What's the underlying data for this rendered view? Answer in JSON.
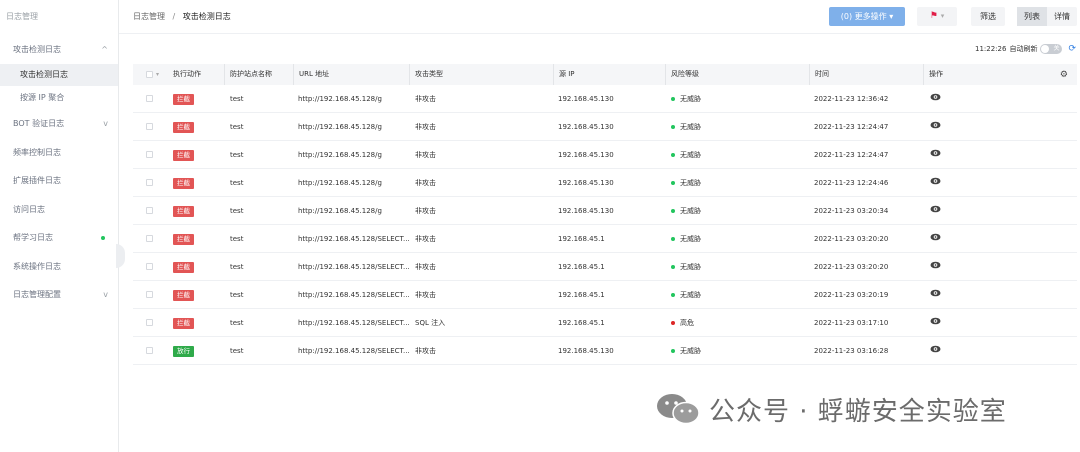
{
  "sidebar": {
    "title": "日志管理",
    "items": [
      {
        "label": "攻击检测日志",
        "chevron": "^"
      },
      {
        "label": "攻击检测日志"
      },
      {
        "label": "按源 IP 聚合"
      },
      {
        "label": "BOT 验证日志",
        "chevron": "v"
      },
      {
        "label": "频率控制日志"
      },
      {
        "label": "扩展插件日志"
      },
      {
        "label": "访问日志"
      },
      {
        "label": "帮学习日志"
      },
      {
        "label": "系统操作日志"
      },
      {
        "label": "日志管理配置",
        "chevron": "v"
      }
    ]
  },
  "header": {
    "breadcrumb_root": "日志管理",
    "breadcrumb_sep": "/",
    "breadcrumb_current": "攻击检测日志",
    "more_actions": "(0) 更多操作 ▾",
    "filter": "筛选",
    "view_list": "列表",
    "view_detail": "详情"
  },
  "refresh": {
    "time": "11:22:26",
    "label": "自动刷新",
    "switch_text": "关"
  },
  "table": {
    "columns": [
      "执行动作",
      "防护站点名称",
      "URL 地址",
      "攻击类型",
      "源 IP",
      "风险等级",
      "时间",
      "操作"
    ],
    "rows": [
      {
        "action": "拦截",
        "site": "test",
        "url": "http://192.168.45.128/g",
        "type": "非攻击",
        "ip": "192.168.45.130",
        "risk": "无威胁",
        "time": "2022-11-23 12:36:42"
      },
      {
        "action": "拦截",
        "site": "test",
        "url": "http://192.168.45.128/g",
        "type": "非攻击",
        "ip": "192.168.45.130",
        "risk": "无威胁",
        "time": "2022-11-23 12:24:47"
      },
      {
        "action": "拦截",
        "site": "test",
        "url": "http://192.168.45.128/g",
        "type": "非攻击",
        "ip": "192.168.45.130",
        "risk": "无威胁",
        "time": "2022-11-23 12:24:47"
      },
      {
        "action": "拦截",
        "site": "test",
        "url": "http://192.168.45.128/g",
        "type": "非攻击",
        "ip": "192.168.45.130",
        "risk": "无威胁",
        "time": "2022-11-23 12:24:46"
      },
      {
        "action": "拦截",
        "site": "test",
        "url": "http://192.168.45.128/g",
        "type": "非攻击",
        "ip": "192.168.45.130",
        "risk": "无威胁",
        "time": "2022-11-23 03:20:34"
      },
      {
        "action": "拦截",
        "site": "test",
        "url": "http://192.168.45.128/SELECT...",
        "type": "非攻击",
        "ip": "192.168.45.1",
        "risk": "无威胁",
        "time": "2022-11-23 03:20:20"
      },
      {
        "action": "拦截",
        "site": "test",
        "url": "http://192.168.45.128/SELECT...",
        "type": "非攻击",
        "ip": "192.168.45.1",
        "risk": "无威胁",
        "time": "2022-11-23 03:20:20"
      },
      {
        "action": "拦截",
        "site": "test",
        "url": "http://192.168.45.128/SELECT...",
        "type": "非攻击",
        "ip": "192.168.45.1",
        "risk": "无威胁",
        "time": "2022-11-23 03:20:19"
      },
      {
        "action": "拦截",
        "site": "test",
        "url": "http://192.168.45.128/SELECT...",
        "type": "SQL 注入",
        "ip": "192.168.45.1",
        "risk": "高危",
        "time": "2022-11-23 03:17:10"
      },
      {
        "action": "放行",
        "site": "test",
        "url": "http://192.168.45.128/SELECT...",
        "type": "非攻击",
        "ip": "192.168.45.130",
        "risk": "无威胁",
        "time": "2022-11-23 03:16:28"
      }
    ]
  },
  "colors": {
    "block": "#e25555",
    "pass": "#2faa4a",
    "safe_dot": "#22c55e",
    "high_dot": "#dc2626",
    "primary": "#7fb0ea"
  },
  "watermark": {
    "text": "公众号 · 蜉蝣安全实验室",
    "icon": "wechat-icon"
  }
}
